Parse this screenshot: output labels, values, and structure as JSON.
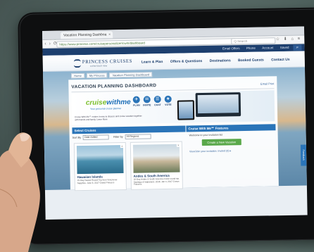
{
  "browser": {
    "tab_title": "Vacation Planning Dashboa",
    "tab_close": "×",
    "nav_arrows": "‹ › ⟳",
    "url": "https://www.princess.com/cruisepersonalizer/cwm/dashboard",
    "search_placeholder": "Q  Search",
    "toolbar_icons": "☆ ⬇ ⌂ ≡"
  },
  "topbar": {
    "items": [
      "Email Offers",
      "Phone",
      "Account",
      "Saved"
    ],
    "search_icon": "search-icon",
    "search_glyph": "⌕"
  },
  "header": {
    "logo": "PRINCESS CRUISES",
    "logo_sub": "come back new",
    "nav": [
      "Learn & Plan",
      "Offers & Questions",
      "Destinations",
      "Booked Guests",
      "Contact Us"
    ]
  },
  "breadcrumb": [
    "Home",
    "My Princess",
    "Vacation Planning Dashboard"
  ],
  "panel": {
    "title": "VACATION PLANNING DASHBOARD",
    "tools": "Email   Print"
  },
  "promo": {
    "brand_a": "cruise",
    "brand_b": "withme",
    "brand_sub": "Your personal cruise planner",
    "steps": [
      {
        "glyph": "✈",
        "label": "PLAN"
      },
      {
        "glyph": "✉",
        "label": "INVITE"
      },
      {
        "glyph": "☰",
        "label": "CHAT"
      },
      {
        "glyph": "★",
        "label": "VOTE"
      }
    ],
    "text": "Cruise With Me℠ makes it easy to discuss and cruise vacation together with friends and family. Learn More"
  },
  "selected_cruises": {
    "heading": "Select Cruises",
    "sort_label": "Sort By",
    "sort_value": "Date Added",
    "filter_label": "Filter by",
    "filter_value": "All Regions",
    "cards": [
      {
        "title": "Hawaiian Islands",
        "text": "15-Day Hawaii Round Trip from Vancouver. Sapphire. June 6, 2017 Grand Princess",
        "close": "×"
      },
      {
        "title": "Andes & South America",
        "text": "16-Day Andes & South America cruise round trip. Santiago & Valparaiso. 2016. Jan 4, 2017 Crown Princess",
        "close": "×"
      }
    ]
  },
  "features": {
    "heading": "Cruise With Me℠ Features",
    "text": "Welcome to your invitation list",
    "button": "Create a New Vacation",
    "more": "View/Join your invitation: Invited (0) ▸"
  },
  "feedback": "Feedback",
  "colors": {
    "brand_navy": "#1d3f6e",
    "accent_blue": "#2a74b8",
    "cta_green": "#5aa84a",
    "cwm_green": "#7bbf2a"
  }
}
